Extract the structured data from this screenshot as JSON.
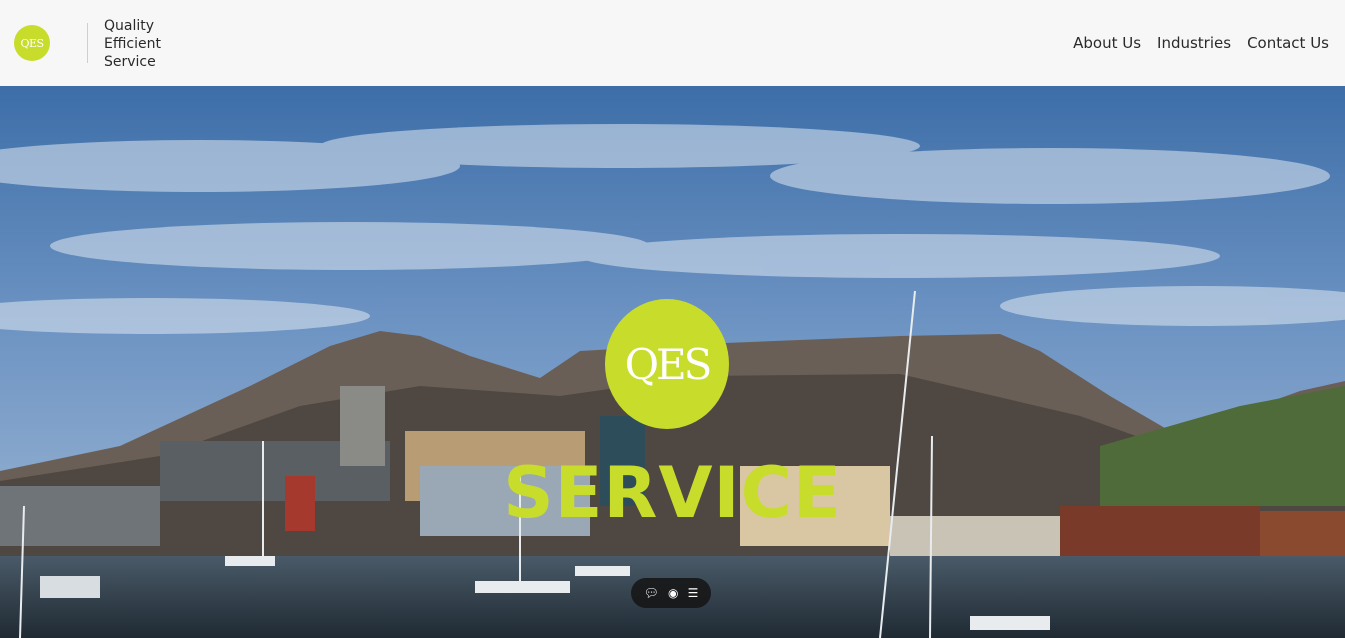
{
  "header": {
    "logo_text": "QES",
    "tagline": [
      "Quality",
      "Efficient",
      "Service"
    ],
    "nav": [
      "About Us",
      "Industries",
      "Contact Us"
    ]
  },
  "hero": {
    "logo_text": "QES",
    "title": "SERVICE"
  },
  "toolbar": {
    "icons": [
      "chat-icon",
      "eye-icon",
      "menu-icon"
    ]
  },
  "colors": {
    "accent": "#c8dc2c",
    "header_bg": "#f7f7f7",
    "text": "#2a2a2a"
  }
}
